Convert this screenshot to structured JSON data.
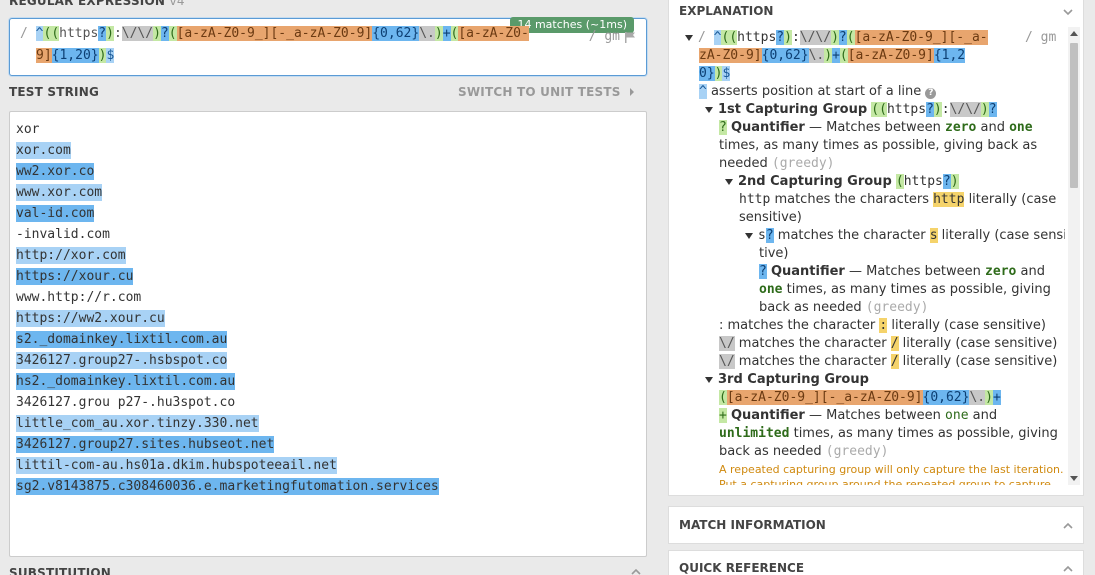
{
  "regex": {
    "header": "REGULAR EXPRESSION",
    "version": "v4",
    "matches_badge": "14 matches (~1ms)",
    "delim_open": "/",
    "delim_close": "/",
    "flags": "gm",
    "line1_tokens": [
      {
        "t": "^",
        "c": "t-anchor"
      },
      {
        "t": "(",
        "c": "t-grp"
      },
      {
        "t": "(",
        "c": "t-grp"
      },
      {
        "t": "https",
        "c": "t-lit"
      },
      {
        "t": "?",
        "c": "t-q"
      },
      {
        "t": ")",
        "c": "t-grp"
      },
      {
        "t": ":",
        "c": "t-lit"
      },
      {
        "t": "\\/\\/",
        "c": "t-esc"
      },
      {
        "t": ")",
        "c": "t-grp"
      },
      {
        "t": "?",
        "c": "t-q"
      },
      {
        "t": "(",
        "c": "t-grp"
      },
      {
        "t": "[a-zA-Z0-9_][-_a-zA-Z0-9]",
        "c": "t-class"
      },
      {
        "t": "{0,62}",
        "c": "t-quant"
      },
      {
        "t": "\\.",
        "c": "t-esc"
      },
      {
        "t": ")",
        "c": "t-grp"
      },
      {
        "t": "+",
        "c": "t-q"
      },
      {
        "t": "(",
        "c": "t-grp"
      },
      {
        "t": "[a-zA-Z0-",
        "c": "t-class"
      }
    ],
    "line2_tokens": [
      {
        "t": "9]",
        "c": "t-class"
      },
      {
        "t": "{1,20}",
        "c": "t-quant"
      },
      {
        "t": ")",
        "c": "t-grp"
      },
      {
        "t": "$",
        "c": "t-anchor"
      }
    ]
  },
  "test": {
    "header": "TEST STRING",
    "switch_label": "SWITCH TO UNIT TESTS",
    "lines": [
      {
        "text": "xor",
        "m": ""
      },
      {
        "text": "xor.com",
        "m": "m1"
      },
      {
        "text": "ww2.xor.co",
        "m": "m2"
      },
      {
        "text": "www.xor.com",
        "m": "m1"
      },
      {
        "text": "val-id.com",
        "m": "m2"
      },
      {
        "text": "-invalid.com",
        "m": ""
      },
      {
        "text": "http://xor.com",
        "m": "m1"
      },
      {
        "text": "https://xour.cu",
        "m": "m2"
      },
      {
        "text": "www.http://r.com",
        "m": ""
      },
      {
        "text": "https://ww2.xour.cu",
        "m": "m1"
      },
      {
        "text": "s2._domainkey.lixtil.com.au",
        "m": "m2"
      },
      {
        "text": "3426127.group27-.hsbspot.co",
        "m": "m1"
      },
      {
        "text": "hs2._domainkey.lixtil.com.au",
        "m": "m2"
      },
      {
        "text": "3426127.grou p27-.hu3spot.co",
        "m": ""
      },
      {
        "text": "little_com_au.xor.tinzy.330.net",
        "m": "m1"
      },
      {
        "text": "3426127.group27.sites.hubseot.net",
        "m": "m2"
      },
      {
        "text": "littil-com-au.hs01a.dkim.hubspoteeail.net",
        "m": "m1"
      },
      {
        "text": "sg2.v8143875.c308460036.e.marketingfutomation.services",
        "m": "m2"
      }
    ]
  },
  "substitution": {
    "header": "SUBSTITUTION"
  },
  "explanation": {
    "title": "EXPLANATION",
    "regex_l1": "^((https?):\\/\\/)?([a-zA-Z0-9_][-_a-",
    "regex_l2": "zA-Z0-9]{0,62}\\.)+([a-zA-Z0-9]{1,2",
    "regex_l3": "0})$",
    "anchor_desc": "asserts position at start of a line",
    "g1_title": "1st Capturing Group",
    "g1_pat": "((https?):\\/\\/)?",
    "quantifier": "Quantifier",
    "q1_a": "— Matches between",
    "zero": "zero",
    "and": "and",
    "one": "one",
    "q1_b": "times, as many times as possible, giving back as",
    "needed": "needed",
    "greedy": "(greedy)",
    "g2_title": "2nd Capturing Group",
    "g2_pat": "(https?)",
    "http_a": "matches the characters",
    "http_lit": "http",
    "http_b": "literally (case",
    "sensitive": "sensitive)",
    "s_a": "matches the character",
    "s_lit": "s",
    "s_b": "literally (case sensi",
    "tive": "tive)",
    "q2_b": "times, as many times as possible, giving",
    "back_as_needed": "back as needed",
    "colon_a": ": matches the character",
    "colon_lit": ":",
    "literally_cs": "literally (case sensitive)",
    "slash_a": "matches the character",
    "slash_lit": "/",
    "g3_title": "3rd Capturing Group",
    "g3_pat": "([a-zA-Z0-9_][-_a-zA-Z0-9]{0,62}\\.)+",
    "plus_q_a": "— Matches between",
    "unlimited": "unlimited",
    "q3_b": "times, as many times as possible, giving",
    "note1": "A repeated capturing group will only capture the last iteration.",
    "note2": "Put a capturing group around the repeated group to capture"
  },
  "match_info": {
    "title": "MATCH INFORMATION"
  },
  "quick_ref": {
    "title": "QUICK REFERENCE"
  }
}
